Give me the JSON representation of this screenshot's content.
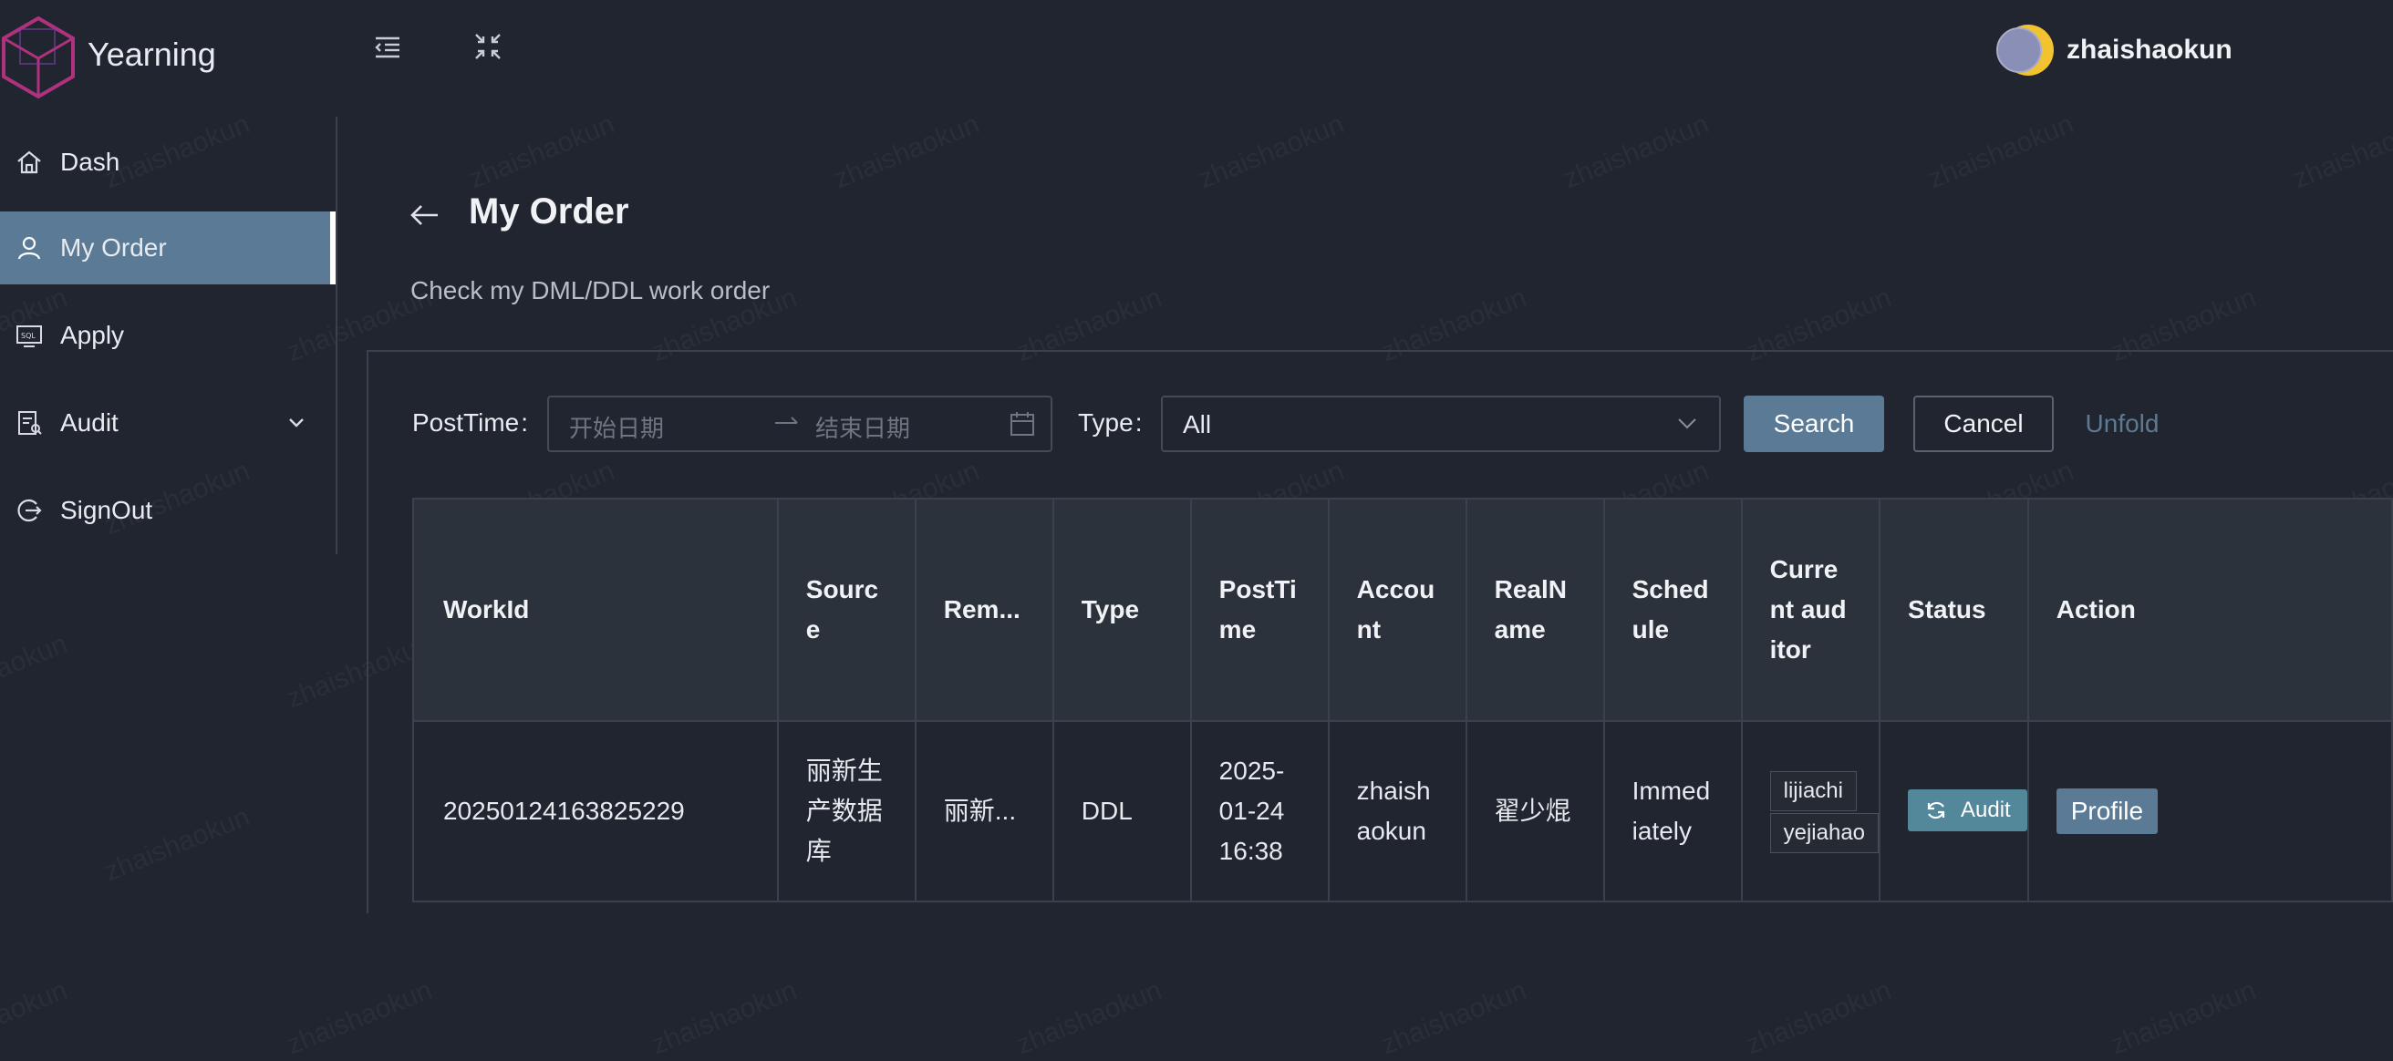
{
  "app": {
    "name": "Yearning"
  },
  "user": {
    "name": "zhaishaokun"
  },
  "watermark": "zhaishaokun",
  "sidebar": {
    "items": [
      {
        "label": "Dash",
        "icon": "home-icon"
      },
      {
        "label": "My Order",
        "icon": "user-icon",
        "active": true
      },
      {
        "label": "Apply",
        "icon": "sql-icon"
      },
      {
        "label": "Audit",
        "icon": "audit-icon",
        "expandable": true
      },
      {
        "label": "SignOut",
        "icon": "signout-icon"
      }
    ]
  },
  "header": {
    "title": "My Order",
    "subtitle": "Check my DML/DDL work order"
  },
  "filters": {
    "post_time_label": "PostTime",
    "start_placeholder": "开始日期",
    "end_placeholder": "结束日期",
    "type_label": "Type",
    "type_value": "All",
    "search_label": "Search",
    "cancel_label": "Cancel",
    "unfold_label": "Unfold"
  },
  "table": {
    "columns": {
      "workid": "WorkId",
      "source": "Source",
      "remark": "Rem...",
      "type": "Type",
      "posttime": "PostTime",
      "account": "Account",
      "realname": "RealName",
      "schedule": "Schedule",
      "auditor": "Current auditor",
      "status": "Status",
      "action": "Action"
    },
    "rows": [
      {
        "workid": "20250124163825229",
        "source": "丽新生产数据库",
        "remark": "丽新...",
        "type": "DDL",
        "posttime": "2025-01-24 16:38",
        "account": "zhaishaokun",
        "realname": "翟少焜",
        "schedule": "Immediately",
        "auditors": [
          "lijiachi",
          "yejiahao"
        ],
        "status": "Audit",
        "action": "Profile"
      }
    ]
  },
  "colors": {
    "accent": "#5a7a96",
    "status_audit": "#52889a",
    "background": "#20252f"
  }
}
